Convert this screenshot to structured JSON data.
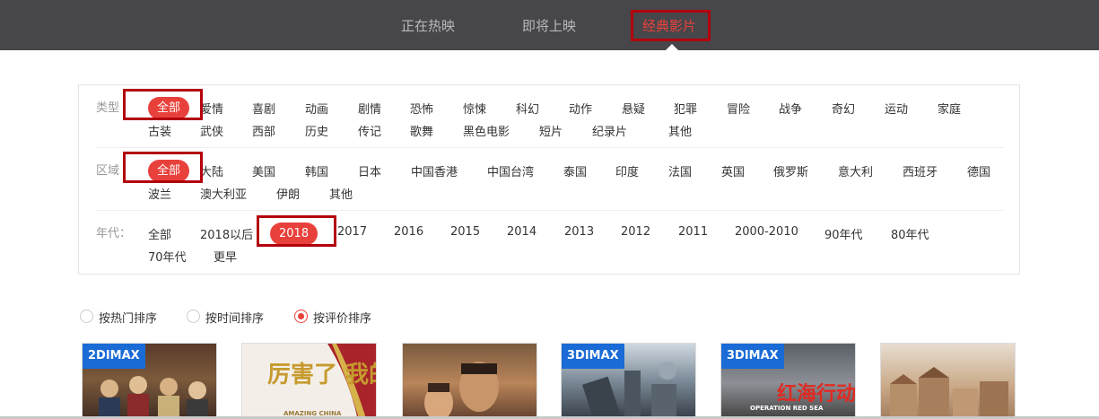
{
  "topnav": {
    "tabs": [
      {
        "label": "正在热映"
      },
      {
        "label": "即将上映"
      },
      {
        "label": "经典影片"
      }
    ],
    "active_tab": "经典影片"
  },
  "filters": {
    "type": {
      "label": "类型",
      "items": [
        "全部",
        "爱情",
        "喜剧",
        "动画",
        "剧情",
        "恐怖",
        "惊悚",
        "科幻",
        "动作",
        "悬疑",
        "犯罪",
        "冒险",
        "战争",
        "奇幻",
        "运动",
        "家庭",
        "古装",
        "武侠",
        "西部",
        "历史",
        "传记",
        "歌舞",
        "黑色电影",
        "短片",
        "纪录片",
        "其他"
      ],
      "selected": "全部"
    },
    "region": {
      "label": "区域",
      "items": [
        "全部",
        "大陆",
        "美国",
        "韩国",
        "日本",
        "中国香港",
        "中国台湾",
        "泰国",
        "印度",
        "法国",
        "英国",
        "俄罗斯",
        "意大利",
        "西班牙",
        "德国",
        "波兰",
        "澳大利亚",
        "伊朗",
        "其他"
      ],
      "selected": "全部"
    },
    "year": {
      "label": "年代：",
      "items": [
        "全部",
        "2018以后",
        "2018",
        "2017",
        "2016",
        "2015",
        "2014",
        "2013",
        "2012",
        "2011",
        "2000-2010",
        "90年代",
        "80年代",
        "70年代",
        "更早"
      ],
      "selected": "2018"
    }
  },
  "sort": {
    "options": [
      {
        "label": "按热门排序",
        "checked": false
      },
      {
        "label": "按时间排序",
        "checked": false
      },
      {
        "label": "按评价排序",
        "checked": true
      }
    ]
  },
  "posters": [
    {
      "badge": "2DIMAX",
      "title": ""
    },
    {
      "badge": "",
      "title": "厉害了 我的国",
      "subtitle": "AMAZING CHINA"
    },
    {
      "badge": "",
      "title": ""
    },
    {
      "badge": "3DIMAX",
      "title": ""
    },
    {
      "badge": "3DIMAX",
      "title": "红海行动",
      "subtitle": "OPERATION RED SEA"
    },
    {
      "badge": "",
      "title": ""
    }
  ],
  "colors": {
    "accent": "#e8413c",
    "nav_bg": "#47464a",
    "highlight_box": "#b3000c",
    "imax_badge": "#1a6bd6"
  }
}
